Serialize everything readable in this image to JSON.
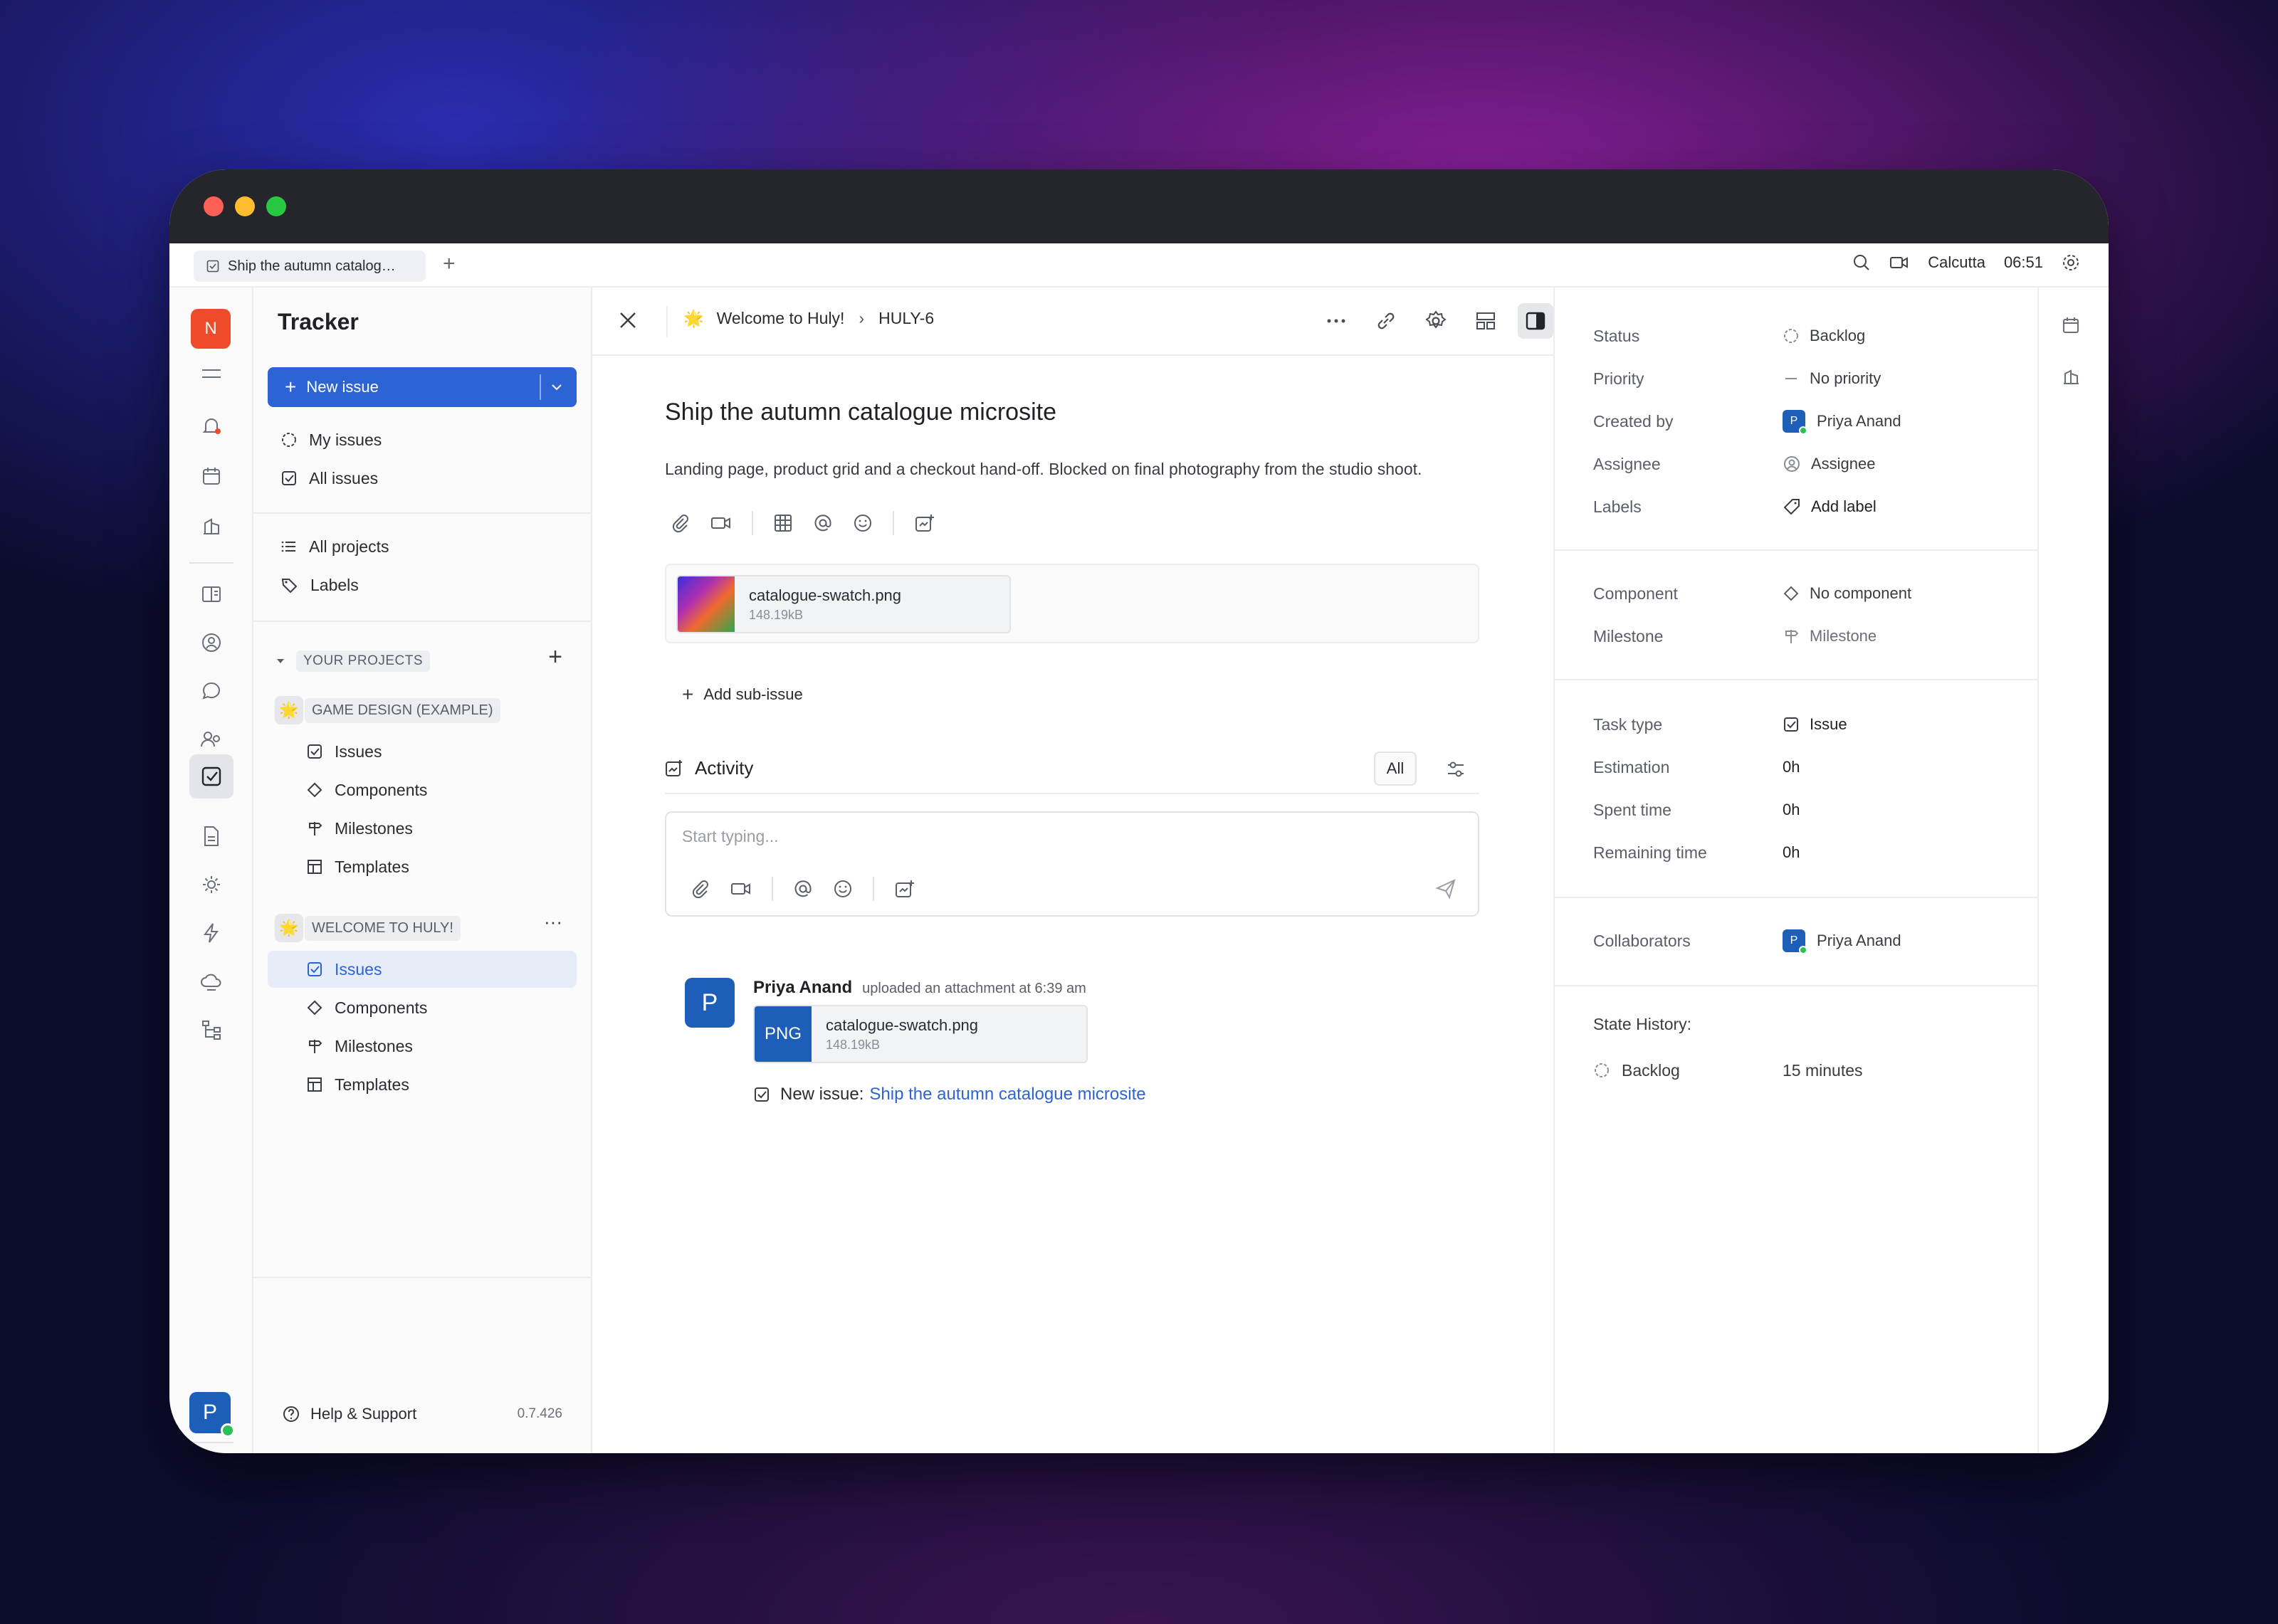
{
  "tab": {
    "title": "Ship the autumn catalog…"
  },
  "topbar": {
    "location": "Calcutta",
    "time": "06:51"
  },
  "workspace": {
    "initial": "N"
  },
  "user": {
    "initial": "P"
  },
  "nav": {
    "title": "Tracker",
    "new_issue": "New issue",
    "my_issues": "My issues",
    "all_issues": "All issues",
    "all_projects": "All projects",
    "labels": "Labels",
    "your_projects": "YOUR PROJECTS",
    "projects": [
      {
        "emoji": "🌟",
        "name": "GAME DESIGN (EXAMPLE)",
        "items": [
          "Issues",
          "Components",
          "Milestones",
          "Templates"
        ]
      },
      {
        "emoji": "🌟",
        "name": "WELCOME TO HULY!",
        "items": [
          "Issues",
          "Components",
          "Milestones",
          "Templates"
        ]
      }
    ],
    "help": "Help & Support",
    "version": "0.7.426"
  },
  "header": {
    "project_emoji": "🌟",
    "project": "Welcome to Huly!",
    "issue_id": "HULY-6"
  },
  "issue": {
    "title": "Ship the autumn catalogue microsite",
    "description": "Landing page, product grid and a checkout hand-off. Blocked on final photography from the studio shoot.",
    "attachment": {
      "name": "catalogue-swatch.png",
      "size": "148.19kB"
    },
    "add_sub_issue": "Add sub-issue"
  },
  "activity": {
    "title": "Activity",
    "filter": "All",
    "placeholder": "Start typing...",
    "entry": {
      "avatar": "P",
      "author": "Priya Anand",
      "action": "uploaded an attachment at 6:39 am",
      "file_badge": "PNG",
      "file_name": "catalogue-swatch.png",
      "file_size": "148.19kB",
      "new_issue_prefix": "New issue:",
      "new_issue_link": "Ship the autumn catalogue microsite"
    }
  },
  "properties": {
    "status": {
      "label": "Status",
      "value": "Backlog"
    },
    "priority": {
      "label": "Priority",
      "value": "No priority"
    },
    "created_by": {
      "label": "Created by",
      "value": "Priya Anand",
      "initial": "P"
    },
    "assignee": {
      "label": "Assignee",
      "value": "Assignee"
    },
    "labels": {
      "label": "Labels",
      "value": "Add label"
    },
    "component": {
      "label": "Component",
      "value": "No component"
    },
    "milestone": {
      "label": "Milestone",
      "value": "Milestone"
    },
    "task_type": {
      "label": "Task type",
      "value": "Issue"
    },
    "estimation": {
      "label": "Estimation",
      "value": "0h"
    },
    "spent_time": {
      "label": "Spent time",
      "value": "0h"
    },
    "remaining_time": {
      "label": "Remaining time",
      "value": "0h"
    },
    "collaborators": {
      "label": "Collaborators",
      "value": "Priya Anand",
      "initial": "P"
    },
    "state_history": {
      "label": "State History:",
      "state": "Backlog",
      "duration": "15 minutes"
    }
  },
  "colors": {
    "accent": "#2c64d6",
    "workspace": "#ef4b2b",
    "avatar": "#1d5eb8",
    "online": "#2bbf55"
  }
}
